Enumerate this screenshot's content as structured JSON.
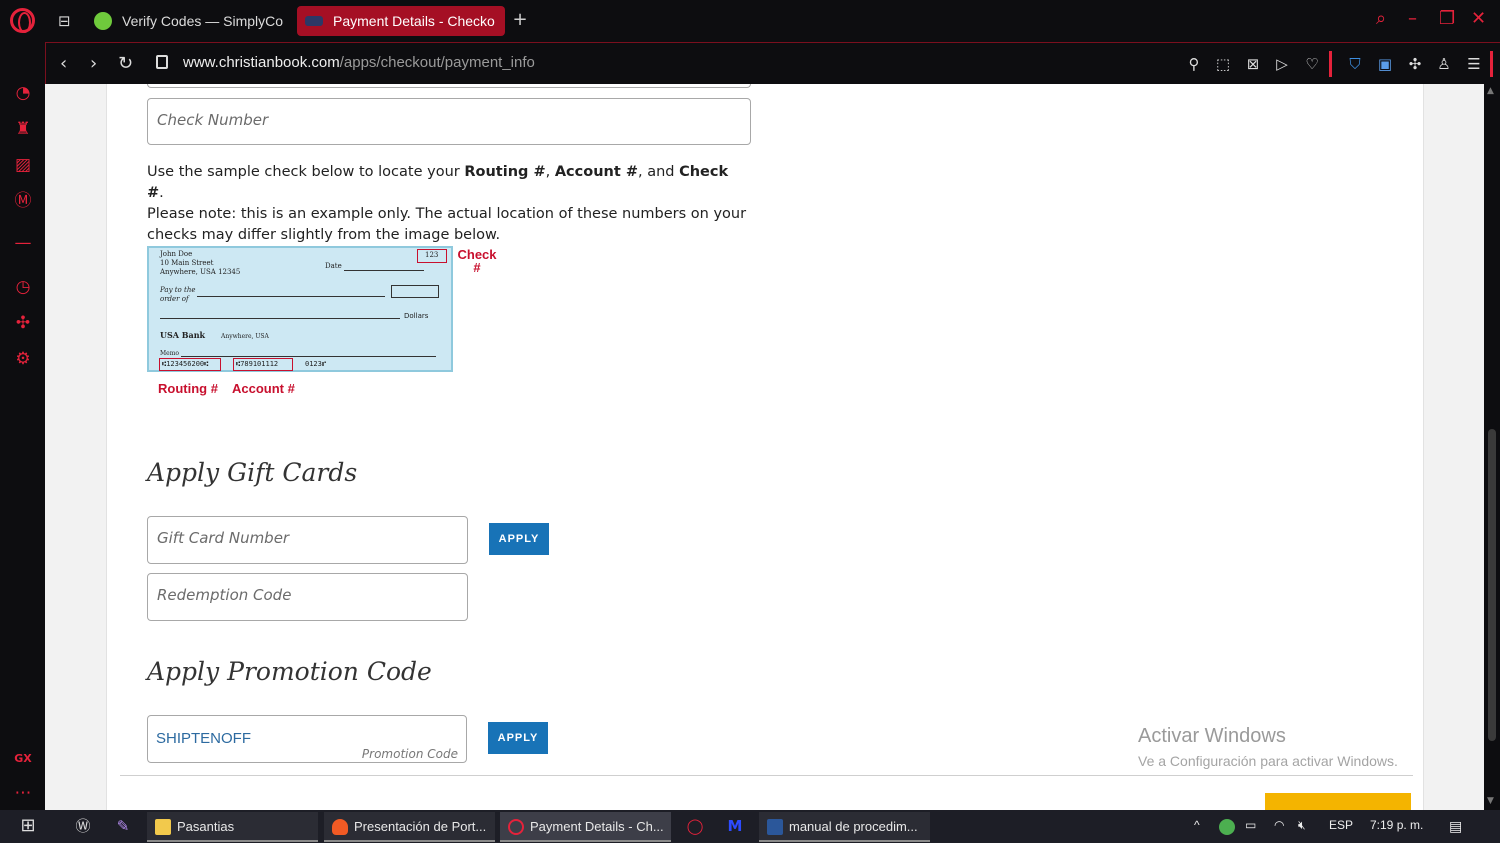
{
  "browser": {
    "tabs": [
      {
        "label": "Verify Codes — SimplyCo",
        "active": false
      },
      {
        "label": "Payment Details - Checko",
        "active": true
      }
    ],
    "new_tab": "+",
    "url_domain": "www.christianbook.com",
    "url_path": "/apps/checkout/payment_info",
    "accent_color": "#e5223b",
    "sidebar_bottom_label": "GX"
  },
  "page": {
    "check_number_placeholder": "Check Number",
    "instructions": {
      "line1_pre": "Use the sample check below to locate your ",
      "routing": "Routing #",
      "sep1": ", ",
      "account": "Account #",
      "sep2": ", and ",
      "check": "Check #",
      "end": ".",
      "line2": "Please note: this is an example only. The actual location of these numbers on your checks may differ slightly from the image below."
    },
    "sample_check": {
      "name": "John Doe",
      "street": "10 Main Street",
      "city": "Anywhere, USA 12345",
      "date_label": "Date",
      "check_no": "123",
      "pay_to": "Pay to the order of",
      "dollars": "Dollars",
      "bank": "USA Bank",
      "bank_loc": "Anywhere, USA",
      "memo": "Memo",
      "routing_digits": "⑆123456200⑆",
      "account_digits": "⑆789101112",
      "check_digits": "0123⑈",
      "label_check": "Check #",
      "label_routing": "Routing #",
      "label_account": "Account #"
    },
    "gift_cards": {
      "heading": "Apply Gift Cards",
      "card_placeholder": "Gift Card Number",
      "redemption_placeholder": "Redemption Code",
      "apply_label": "APPLY"
    },
    "promotion": {
      "heading": "Apply Promotion Code",
      "value": "SHIPTENOFF",
      "field_label": "Promotion Code",
      "apply_label": "APPLY"
    },
    "activate_windows": {
      "title": "Activar Windows",
      "subtitle": "Ve a Configuración para activar Windows."
    }
  },
  "taskbar": {
    "apps": [
      {
        "label": "Pasantias"
      },
      {
        "label": "Presentación de Port..."
      },
      {
        "label": "Payment Details - Ch..."
      },
      {
        "label": "manual de procedim..."
      }
    ],
    "language": "ESP",
    "time": "7:19 p. m."
  }
}
